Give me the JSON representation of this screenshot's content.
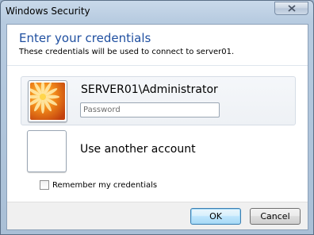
{
  "window": {
    "title": "Windows Security"
  },
  "dialog": {
    "heading": "Enter your credentials",
    "subheading": "These credentials will be used to connect to server01."
  },
  "accounts": [
    {
      "name": "SERVER01\\Administrator",
      "password_placeholder": "Password",
      "password_value": "",
      "avatar_icon": "flower-avatar-icon"
    },
    {
      "name": "Use another account",
      "avatar_icon": "blank-avatar-icon"
    }
  ],
  "remember": {
    "label": "Remember my credentials",
    "checked": false
  },
  "buttons": {
    "ok": "OK",
    "cancel": "Cancel"
  },
  "colors": {
    "heading": "#1f4fa0",
    "title_bar": "#b7cbe0"
  }
}
